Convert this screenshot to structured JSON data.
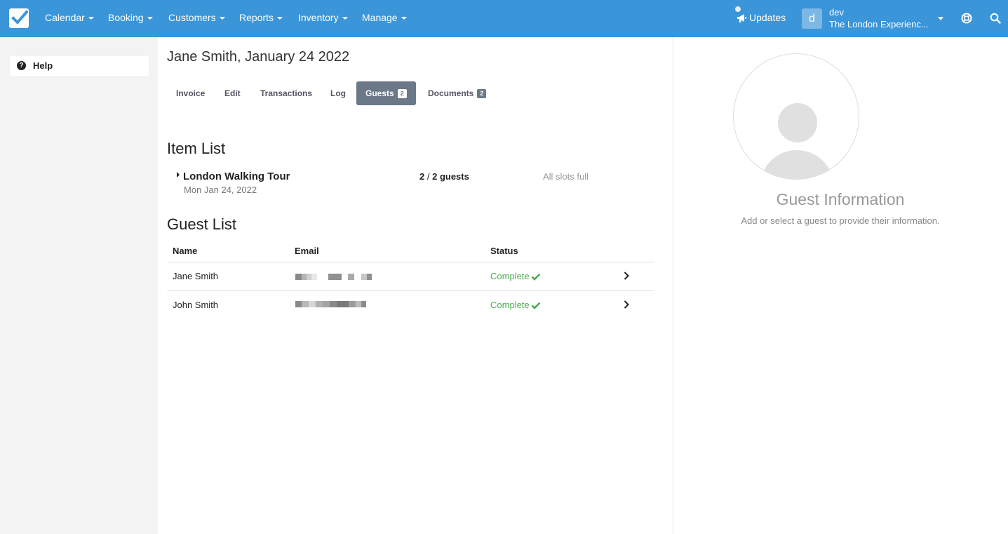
{
  "topbar": {
    "logo_icon": "checkbox-logo-icon",
    "nav": [
      "Calendar",
      "Booking",
      "Customers",
      "Reports",
      "Inventory",
      "Manage"
    ],
    "updates_label": "Updates",
    "user_initial": "d",
    "user_name": "dev",
    "user_org": "The London Experienc...",
    "help_icon": "lifebuoy-icon",
    "search_icon": "search-icon",
    "accent_color": "#3a95d9"
  },
  "sidebar": {
    "help_label": "Help"
  },
  "main": {
    "title": "Jane Smith, January 24 2022",
    "tabs": [
      {
        "label": "Invoice",
        "badge": ""
      },
      {
        "label": "Edit",
        "badge": ""
      },
      {
        "label": "Transactions",
        "badge": ""
      },
      {
        "label": "Log",
        "badge": ""
      },
      {
        "label": "Guests",
        "badge": "2",
        "active": true
      },
      {
        "label": "Documents",
        "badge": "2"
      }
    ],
    "item_list": {
      "title": "Item List",
      "items": [
        {
          "name": "London Walking Tour",
          "date": "Mon Jan 24, 2022",
          "count": "2",
          "capacity": "2",
          "count_suffix": "guests",
          "slots": "All slots full"
        }
      ]
    },
    "guest_list": {
      "title": "Guest List",
      "columns": [
        "Name",
        "Email",
        "Status"
      ],
      "rows": [
        {
          "name": "Jane Smith",
          "status": "Complete"
        },
        {
          "name": "John Smith",
          "status": "Complete"
        }
      ],
      "status_color": "#4aae4f"
    }
  },
  "right_panel": {
    "title": "Guest Information",
    "subtitle": "Add or select a guest to provide their information."
  }
}
